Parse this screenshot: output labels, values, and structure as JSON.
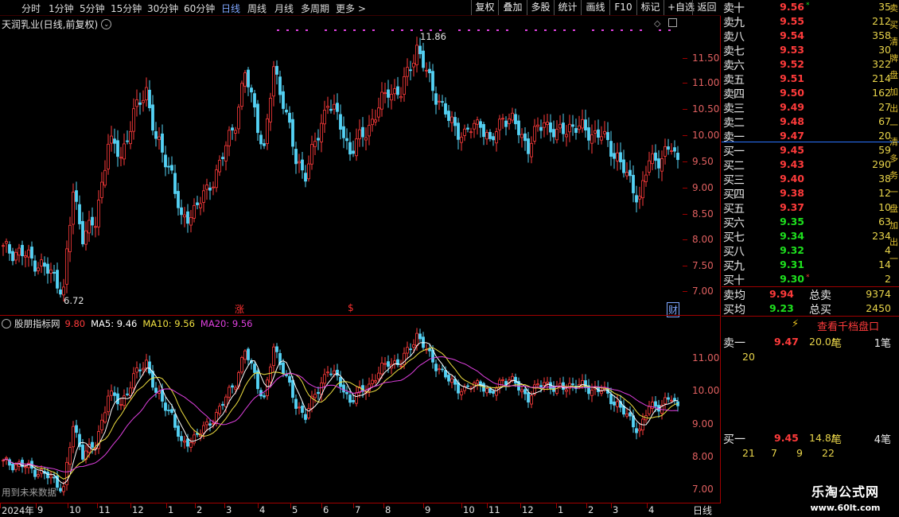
{
  "toolbar": {
    "periods": [
      {
        "label": "分时",
        "active": false
      },
      {
        "label": "1分钟",
        "active": false
      },
      {
        "label": "5分钟",
        "active": false
      },
      {
        "label": "15分钟",
        "active": false
      },
      {
        "label": "30分钟",
        "active": false
      },
      {
        "label": "60分钟",
        "active": false
      },
      {
        "label": "日线",
        "active": true
      },
      {
        "label": "周线",
        "active": false
      },
      {
        "label": "月线",
        "active": false
      },
      {
        "label": "多周期",
        "active": false
      },
      {
        "label": "更多 >",
        "active": false
      }
    ],
    "buttons": [
      "复权",
      "叠加",
      "多股",
      "统计",
      "画线",
      "F10",
      "标记",
      "+自选",
      "返回"
    ]
  },
  "main_chart": {
    "title": "天润乳业(日线,前复权)",
    "high_label": "11.86",
    "low_label": "6.72",
    "ticks": [
      "11.50",
      "11.00",
      "10.50",
      "10.00",
      "9.50",
      "9.00",
      "8.50",
      "8.00",
      "7.50",
      "7.00"
    ],
    "markers": [
      {
        "text": "涨",
        "color": "#ff3030"
      },
      {
        "text": "$",
        "color": "#ff3030"
      },
      {
        "text": "财",
        "color": "#7fa7ff"
      }
    ]
  },
  "indicator": {
    "name": "股朋指标网",
    "value": "9.80",
    "ma5_label": "MA5: 9.46",
    "ma10_label": "MA10: 9.56",
    "ma20_label": "MA20: 9.56",
    "ticks": [
      "11.00",
      "10.00",
      "9.00",
      "8.00",
      "7.00"
    ],
    "note": "用到未来数据"
  },
  "time_axis": {
    "labels": [
      "2024年",
      "9",
      "10",
      "11",
      "12",
      "1",
      "2",
      "3",
      "4",
      "5",
      "6",
      "7",
      "8",
      "9",
      "10",
      "11",
      "12",
      "1",
      "2",
      "3",
      "4"
    ],
    "period_label": "日线"
  },
  "order_book": {
    "asks": [
      {
        "label": "卖十",
        "price": "9.56",
        "vol": "35",
        "star": "*"
      },
      {
        "label": "卖九",
        "price": "9.55",
        "vol": "212"
      },
      {
        "label": "卖八",
        "price": "9.54",
        "vol": "358"
      },
      {
        "label": "卖七",
        "price": "9.53",
        "vol": "30"
      },
      {
        "label": "卖六",
        "price": "9.52",
        "vol": "322"
      },
      {
        "label": "卖五",
        "price": "9.51",
        "vol": "214"
      },
      {
        "label": "卖四",
        "price": "9.50",
        "vol": "162"
      },
      {
        "label": "卖三",
        "price": "9.49",
        "vol": "27"
      },
      {
        "label": "卖二",
        "price": "9.48",
        "vol": "67"
      },
      {
        "label": "卖一",
        "price": "9.47",
        "vol": "20"
      }
    ],
    "bids": [
      {
        "label": "买一",
        "price": "9.45",
        "vol": "59",
        "color": "red"
      },
      {
        "label": "买二",
        "price": "9.43",
        "vol": "290",
        "color": "red"
      },
      {
        "label": "买三",
        "price": "9.40",
        "vol": "38",
        "color": "red"
      },
      {
        "label": "买四",
        "price": "9.38",
        "vol": "12",
        "color": "red"
      },
      {
        "label": "买五",
        "price": "9.37",
        "vol": "10",
        "color": "red"
      },
      {
        "label": "买六",
        "price": "9.35",
        "vol": "63",
        "color": "green"
      },
      {
        "label": "买七",
        "price": "9.34",
        "vol": "234",
        "color": "green"
      },
      {
        "label": "买八",
        "price": "9.32",
        "vol": "4",
        "color": "green"
      },
      {
        "label": "买九",
        "price": "9.31",
        "vol": "14",
        "color": "green"
      },
      {
        "label": "买十",
        "price": "9.30",
        "vol": "2",
        "color": "green",
        "star": "*"
      }
    ],
    "avg_sell": {
      "label": "卖均",
      "price": "9.94",
      "total_label": "总卖",
      "total": "9374"
    },
    "avg_buy": {
      "label": "买均",
      "price": "9.23",
      "total_label": "总买",
      "total": "2450"
    },
    "thousand_button": "查看千档盘口",
    "sell1_detail": {
      "label": "卖一",
      "price": "9.47",
      "lots": "20.0/",
      "unit": "笔",
      "count": "1笔",
      "orders": [
        "20"
      ]
    },
    "buy1_detail": {
      "label": "买一",
      "price": "9.45",
      "lots": "14.8/",
      "unit": "笔",
      "count": "4笔",
      "orders": [
        "21",
        "7",
        "9",
        "22"
      ]
    },
    "side_strip": [
      "卖",
      "买",
      "清",
      "牌",
      "盘",
      "加",
      "出",
      "一",
      "清",
      "多",
      "务",
      "一",
      "盘",
      "加",
      "出",
      "一"
    ]
  },
  "watermark": {
    "site": "乐淘公式网",
    "url": "www.60lt.com"
  },
  "colors": {
    "up": "#ff3b3b",
    "down": "#54d2f5",
    "grid": "#a00000",
    "ma5": "#ffffff",
    "ma10": "#f0e040",
    "ma20": "#e040e0"
  }
}
